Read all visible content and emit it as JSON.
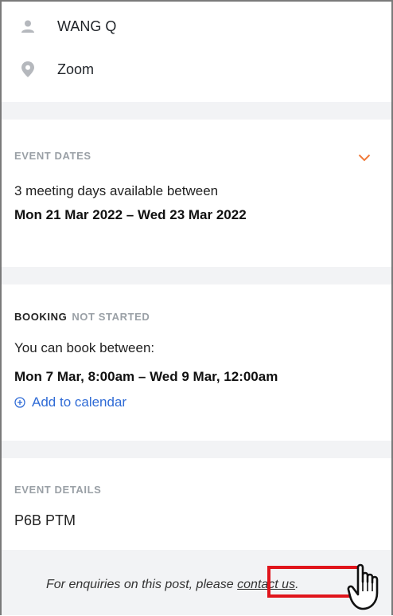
{
  "contact": {
    "name": "WANG Q",
    "location": "Zoom"
  },
  "event_dates": {
    "heading": "EVENT DATES",
    "summary": "3 meeting days available between",
    "range": "Mon 21 Mar 2022 – Wed 23 Mar 2022",
    "accent_color": "#f07a3a"
  },
  "booking": {
    "heading": "BOOKING",
    "status": "NOT STARTED",
    "intro": "You can book between:",
    "window": "Mon 7 Mar, 8:00am – Wed 9 Mar, 12:00am",
    "add_calendar_label": "Add to calendar",
    "link_color": "#2f6bd6"
  },
  "event_details": {
    "heading": "EVENT DETAILS",
    "value": "P6B PTM"
  },
  "footer": {
    "text": "For enquiries on this post, please ",
    "link_label": "contact us",
    "trailing": ".",
    "highlight_color": "#e0141b"
  }
}
